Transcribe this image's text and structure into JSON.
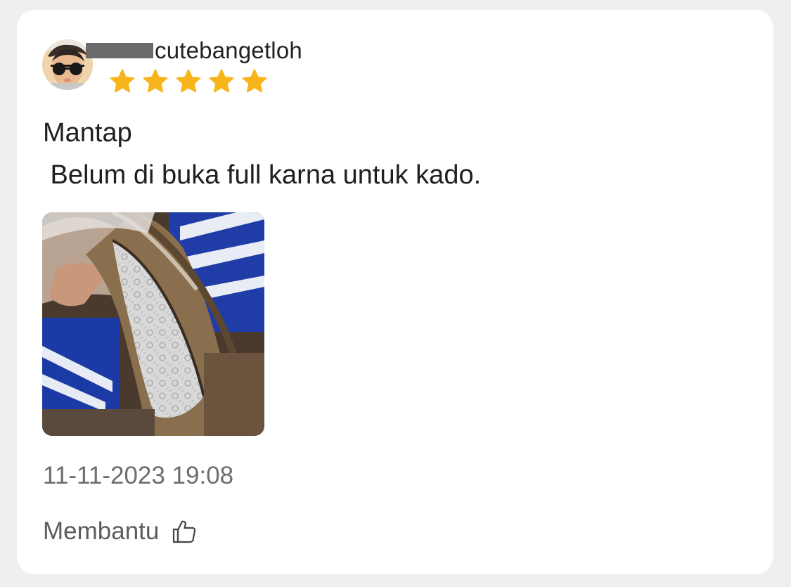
{
  "review": {
    "username": "cutebangetloh",
    "rating": 5,
    "rating_max": 5,
    "title": "Mantap",
    "body": " Belum di buka full karna untuk kado.",
    "timestamp": "11-11-2023 19:08",
    "helpful_label": "Membantu"
  },
  "icons": {
    "avatar": "avatar-photo",
    "star": "star-icon",
    "thumb": "thumbs-up-icon",
    "photo": "review-photo"
  },
  "colors": {
    "star": "#f8b51b",
    "background": "#efefef",
    "card": "#ffffff",
    "text": "#1f1f1f",
    "muted": "#6d6d6d"
  }
}
